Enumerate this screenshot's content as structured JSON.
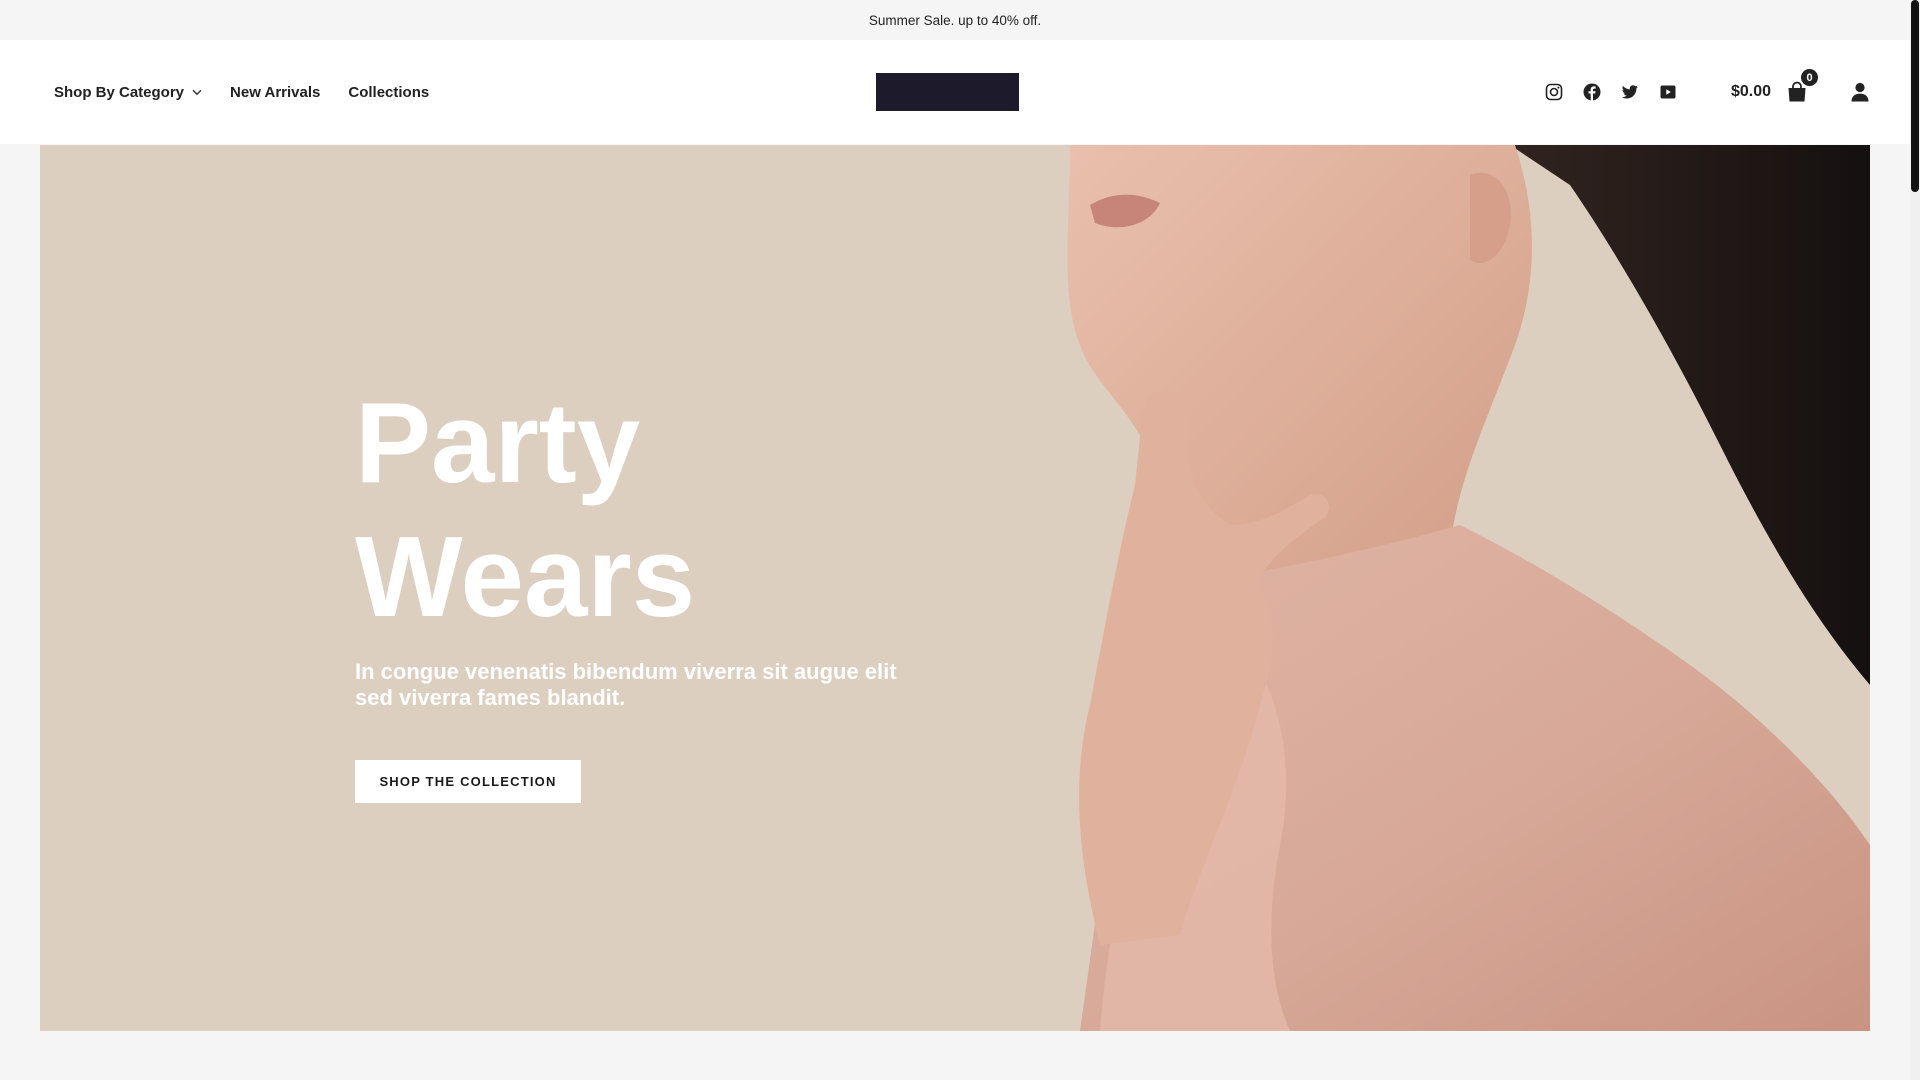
{
  "announcement": {
    "text": "Summer Sale. up to 40% off."
  },
  "nav": {
    "items": [
      {
        "label": "Shop By Category",
        "has_dropdown": true,
        "icon": "chevron-down-icon"
      },
      {
        "label": "New Arrivals"
      },
      {
        "label": "Collections"
      }
    ]
  },
  "social": {
    "icons": [
      "instagram-icon",
      "facebook-icon",
      "twitter-icon",
      "youtube-icon"
    ]
  },
  "cart": {
    "total": "$0.00",
    "count": "0",
    "icon": "shopping-bag-icon"
  },
  "account": {
    "icon": "user-icon"
  },
  "hero": {
    "title_line1": "Party",
    "title_line2": "Wears",
    "subtitle": "In congue venenatis bibendum viverra sit augue elit sed viverra fames blandit.",
    "button_label": "SHOP THE COLLECTION"
  },
  "colors": {
    "hero_background": "#dccfc0",
    "logo": "#1c1a2b",
    "text": "#222222",
    "button_background": "#ffffff",
    "hero_text": "#ffffff"
  }
}
